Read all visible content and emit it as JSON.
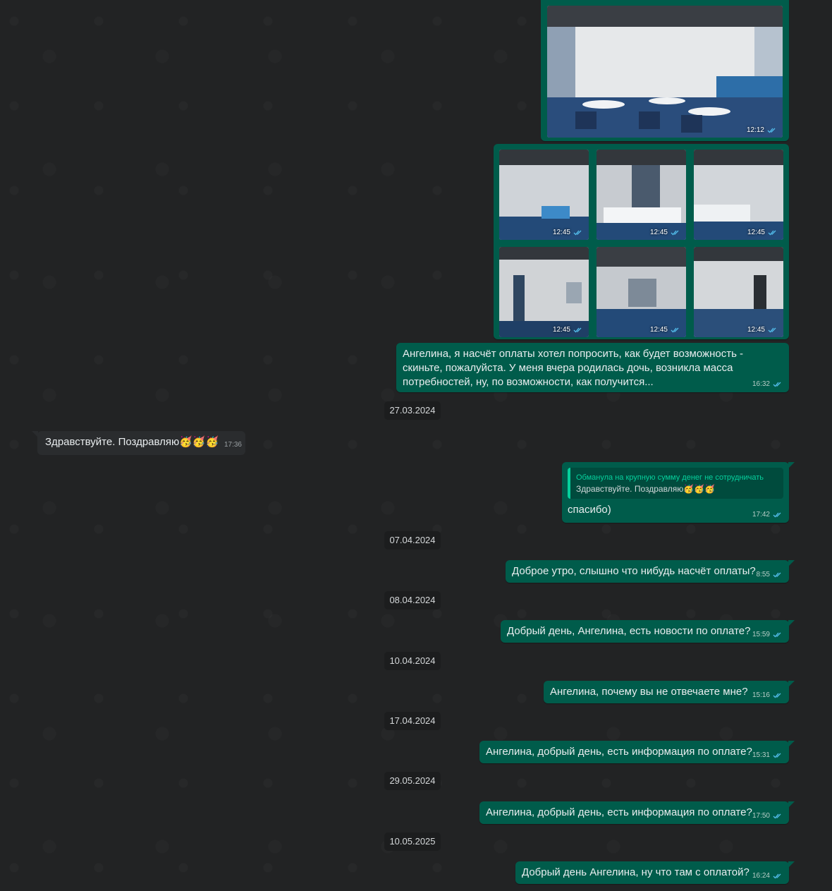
{
  "single_photo": {
    "time": "12:12"
  },
  "album": {
    "photos": [
      {
        "time": "12:45"
      },
      {
        "time": "12:45"
      },
      {
        "time": "12:45"
      },
      {
        "time": "12:45"
      },
      {
        "time": "12:45"
      },
      {
        "time": "12:45"
      }
    ]
  },
  "messages": [
    {
      "id": "m1",
      "text": "Ангелина, я насчёт оплаты хотел попросить, как будет возможность - скиньте, пожалуйста. У меня вчера родилась дочь, возникла масса потребностей, ну, по возможности, как получится...",
      "time": "16:32"
    },
    {
      "id": "m2",
      "text": "Здравствуйте. Поздравляю🥳🥳🥳",
      "time": "17:36"
    },
    {
      "id": "m3",
      "text": "спасибо)",
      "time": "17:42",
      "quote_author": "Обманула на крупную сумму денег не сотрудничать",
      "quote_text": "Здравствуйте. Поздравляю🥳🥳🥳"
    },
    {
      "id": "m4",
      "text": "Доброе утро, слышно что нибудь насчёт оплаты?",
      "time": "8:55"
    },
    {
      "id": "m5",
      "text": "Добрый день, Ангелина, есть новости по оплате?",
      "time": "15:59"
    },
    {
      "id": "m6",
      "text": "Ангелина, почему вы не отвечаете мне?",
      "time": "15:16"
    },
    {
      "id": "m7",
      "text": "Ангелина, добрый день, есть информация по оплате?",
      "time": "15:31"
    },
    {
      "id": "m8",
      "text": "Ангелина, добрый день, есть информация по оплате?",
      "time": "17:50"
    },
    {
      "id": "m9",
      "text": "Добрый день Ангелина, ну что там с оплатой?",
      "time": "16:24"
    }
  ],
  "dates": [
    "27.03.2024",
    "07.04.2024",
    "08.04.2024",
    "10.04.2024",
    "17.04.2024",
    "29.05.2024",
    "10.05.2025"
  ],
  "colors": {
    "outgoing": "#005c4b",
    "incoming": "#2a2c2e",
    "background": "#222324",
    "ticks": "#53bdeb"
  }
}
